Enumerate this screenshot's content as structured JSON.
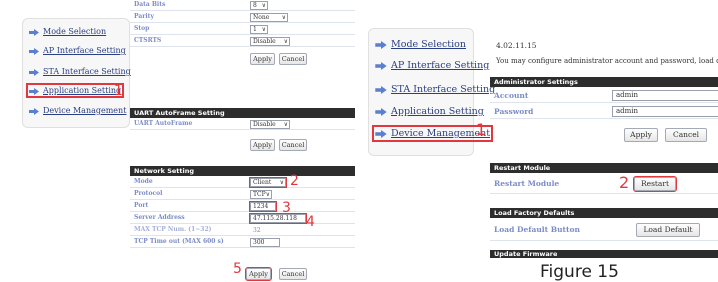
{
  "nav_items": [
    "Mode Selection",
    "AP Interface Setting",
    "STA Interface Setting",
    "Application Setting",
    "Device Management"
  ],
  "left": {
    "serial_rows": [
      {
        "label": "Data Bits",
        "value": "8"
      },
      {
        "label": "Parity",
        "value": "None"
      },
      {
        "label": "Stop",
        "value": "1"
      },
      {
        "label": "CTSRTS",
        "value": "Disable"
      }
    ],
    "apply_label": "Apply",
    "cancel_label": "Cancel",
    "autoframe_header": "UART AutoFrame Setting",
    "autoframe_row": {
      "label": "UART AutoFrame",
      "value": "Disable"
    },
    "network_header": "Network Setting",
    "network_rows": [
      {
        "label": "Mode",
        "value": "Client"
      },
      {
        "label": "Protocol",
        "value": "TCP"
      },
      {
        "label": "Port",
        "value": "1234"
      },
      {
        "label": "Server Address",
        "value": "47.115.28.118"
      },
      {
        "label": "MAX TCP Num. (1~32)",
        "value": "32"
      },
      {
        "label": "TCP Time out (MAX 600 s)",
        "value": "300"
      }
    ],
    "step_numbers": [
      "1",
      "2",
      "3",
      "4",
      "5"
    ]
  },
  "right": {
    "version": "4.02.11.15",
    "description": "You may configure administrator account and password, load defa",
    "admin_header": "Administrator Settings",
    "admin_rows": [
      {
        "label": "Account",
        "value": "admin"
      },
      {
        "label": "Password",
        "value": "admin"
      }
    ],
    "apply_label": "Apply",
    "cancel_label": "Cancel",
    "restart_header": "Restart Module",
    "restart_label": "Restart Module",
    "restart_button": "Restart",
    "factory_header": "Load Factory Defaults",
    "factory_label": "Load Default Button",
    "factory_button": "Load Default",
    "firmware_header": "Update Firmware",
    "step_numbers": [
      "1",
      "2"
    ],
    "caption": "Figure 15"
  },
  "colors": {
    "accent_red": "#e0383e",
    "link_blue": "#2a3f84",
    "label_blue": "#7b8bc7",
    "header_dark": "#2d2d2d"
  },
  "icons": {
    "nav_arrow": "arrow-right-icon",
    "select_caret": "chevron-down-icon"
  }
}
